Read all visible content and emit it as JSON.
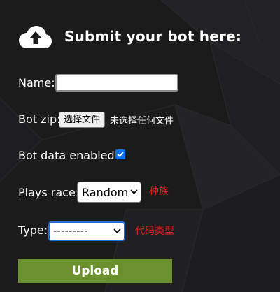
{
  "header": {
    "title": "Submit your bot here:",
    "icon": "cloud-upload-icon"
  },
  "form": {
    "name_label": "Name:",
    "name_value": "",
    "zip_label": "Bot zip:",
    "file_button_label": "选择文件",
    "file_status": "未选择任何文件",
    "data_label": "Bot data enabled:",
    "data_enabled": true,
    "race_label": "Plays race:",
    "race_selected": "Random",
    "race_note": "种族",
    "type_label": "Type:",
    "type_selected": "---------",
    "type_note": "代码类型",
    "upload_label": "Upload"
  },
  "colors": {
    "background": "#1b1b1c",
    "text": "#ffffff",
    "upload_button": "#6b912e",
    "note": "#e02020",
    "checkbox": "#0a70f0",
    "focus_border": "#1f6fd6"
  }
}
